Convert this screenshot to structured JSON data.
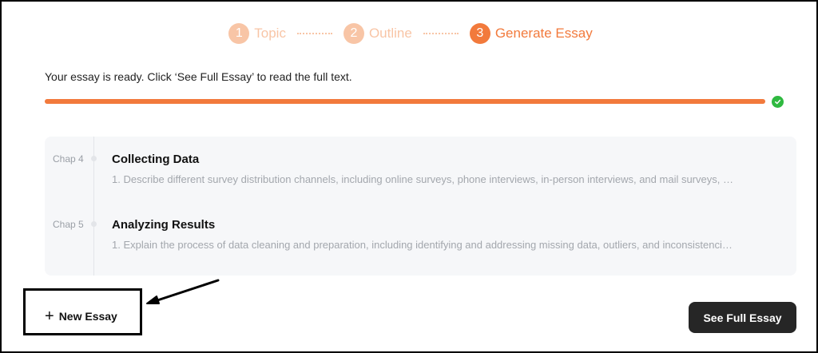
{
  "stepper": {
    "steps": [
      {
        "num": "1",
        "label": "Topic"
      },
      {
        "num": "2",
        "label": "Outline"
      },
      {
        "num": "3",
        "label": "Generate Essay"
      }
    ]
  },
  "status": {
    "message": "Your essay is ready. Click ‘See Full Essay’ to read the full text.",
    "progress_percent": 100
  },
  "chapters": [
    {
      "tag": "Chap 4",
      "title": "Collecting Data",
      "desc": "1. Describe different survey distribution channels, including online surveys, phone interviews, in-person interviews, and mail surveys, …"
    },
    {
      "tag": "Chap 5",
      "title": "Analyzing Results",
      "desc": "1. Explain the process of data cleaning and preparation, including identifying and addressing missing data, outliers, and inconsistenci…"
    }
  ],
  "actions": {
    "new_essay_plus": "+",
    "new_essay_label": "New Essay",
    "see_full_label": "See Full Essay"
  },
  "colors": {
    "accent": "#f27a3c",
    "accent_light": "#f8c5a6",
    "success": "#2fb940",
    "button_dark": "#262626"
  },
  "icons": {
    "check": "check-circle-icon",
    "plus": "plus-icon",
    "annotation_arrow": "arrow-icon"
  }
}
